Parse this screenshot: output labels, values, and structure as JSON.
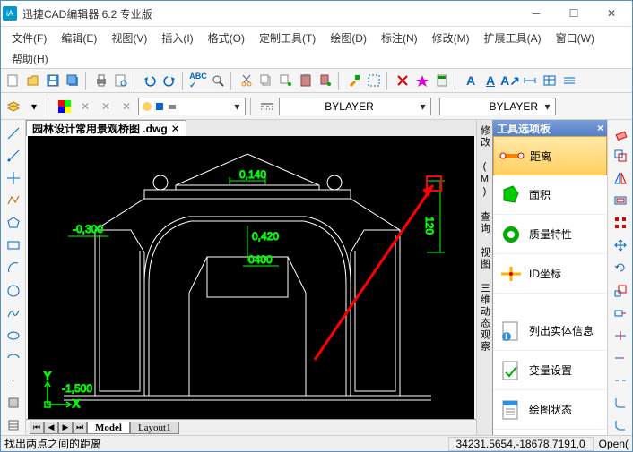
{
  "title": "迅捷CAD编辑器 6.2 专业版",
  "menu": [
    "文件(F)",
    "编辑(E)",
    "视图(V)",
    "插入(I)",
    "格式(O)",
    "定制工具(T)",
    "绘图(D)",
    "标注(N)",
    "修改(M)",
    "扩展工具(A)",
    "窗口(W)",
    "帮助(H)"
  ],
  "layer_combo": "BYLAYER",
  "layer_combo2": "BYLAYER",
  "doc_tab": "园林设计常用景观桥图 .dwg",
  "layout_tabs": {
    "model": "Model",
    "l1": "Layout1"
  },
  "vtabs": [
    "修改 (M)",
    "查询",
    "视图",
    "三维动态观察"
  ],
  "palette_title": "工具选项板",
  "palette_items": [
    {
      "label": "距离",
      "icon": "distance"
    },
    {
      "label": "面积",
      "icon": "area"
    },
    {
      "label": "质量特性",
      "icon": "mass"
    },
    {
      "label": "ID坐标",
      "icon": "idpoint"
    },
    {
      "label": "列出实体信息",
      "icon": "list"
    },
    {
      "label": "变量设置",
      "icon": "var"
    },
    {
      "label": "绘图状态",
      "icon": "status"
    }
  ],
  "status_hint": "找出两点之间的距离",
  "status_coords": "34231.5654,-18678.7191,0",
  "status_right": "Open(",
  "dim_labels": {
    "a": "0,140",
    "b": "-0,300",
    "c": "0,420",
    "d": "0400",
    "e": "-1,500"
  }
}
